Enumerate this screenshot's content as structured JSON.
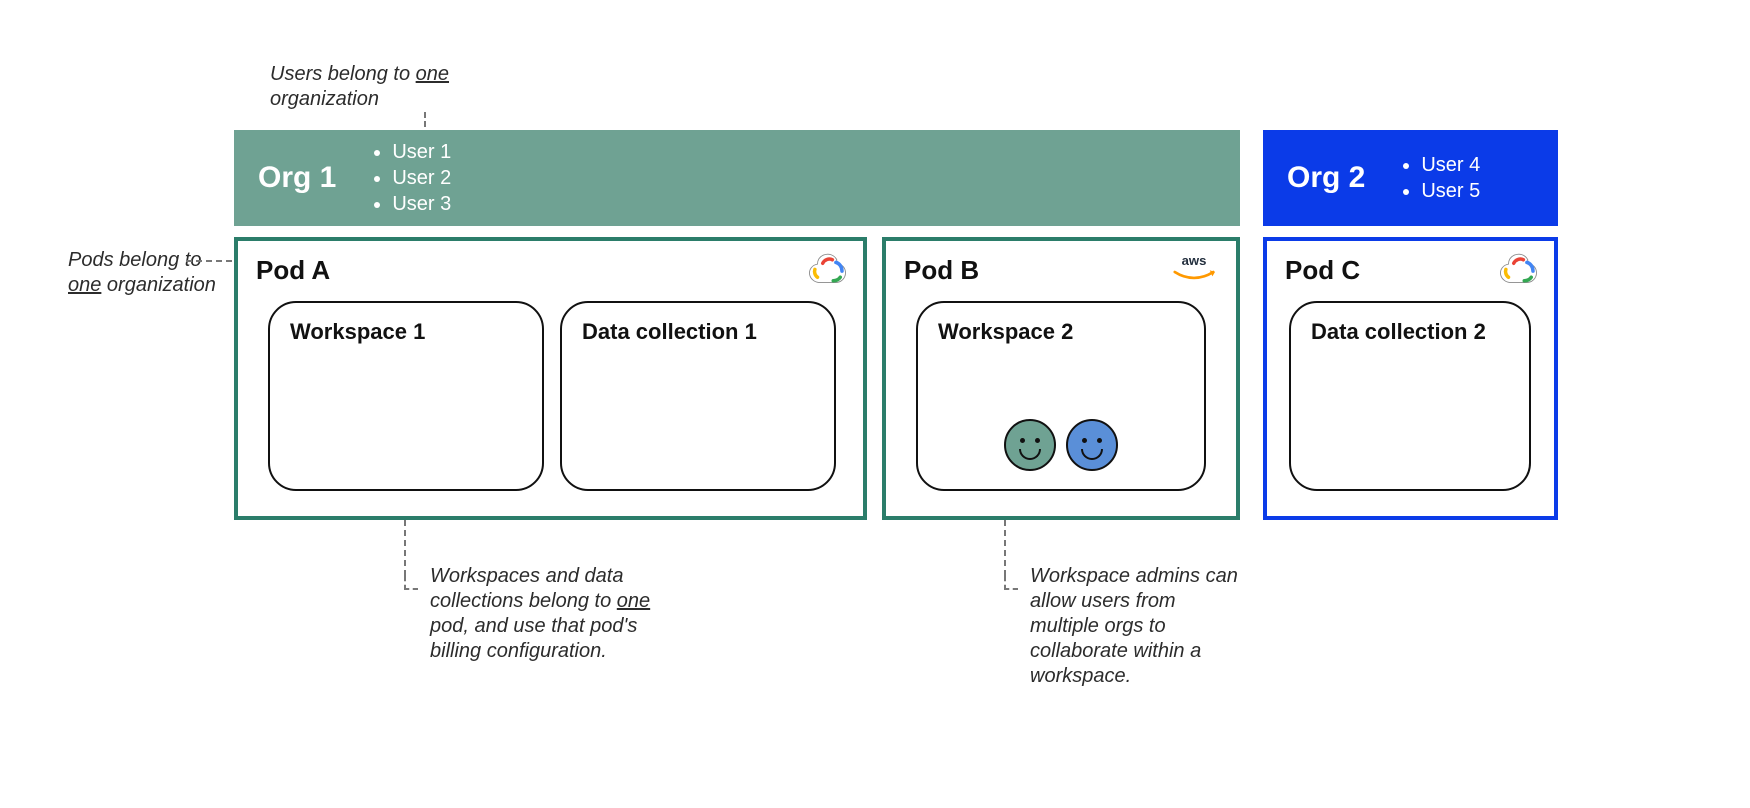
{
  "annotations": {
    "users_belong_pre": "Users belong to ",
    "users_belong_u": "one",
    "users_belong_post": " organization",
    "pods_belong_pre": "Pods belong to ",
    "pods_belong_u": "one",
    "pods_belong_post": " organization",
    "workspaces_pre": "Workspaces and data collections belong to ",
    "workspaces_u": "one",
    "workspaces_post": " pod, and  use that pod's billing configuration.",
    "admins": "Workspace admins can allow users from multiple orgs to collaborate within a workspace."
  },
  "org1": {
    "title": "Org 1",
    "users": [
      "User 1",
      "User 2",
      "User 3"
    ]
  },
  "org2": {
    "title": "Org 2",
    "users": [
      "User 4",
      "User 5"
    ]
  },
  "podA": {
    "title": "Pod A",
    "cloud": "gcp",
    "boxes": [
      {
        "title": "Workspace 1"
      },
      {
        "title": "Data collection 1"
      }
    ]
  },
  "podB": {
    "title": "Pod B",
    "cloud": "aws",
    "boxes": [
      {
        "title": "Workspace 2",
        "faces": [
          "green",
          "blue"
        ]
      }
    ]
  },
  "podC": {
    "title": "Pod C",
    "cloud": "gcp",
    "boxes": [
      {
        "title": "Data collection 2"
      }
    ]
  },
  "colors": {
    "org1": "#6fa293",
    "org2": "#0b3be8",
    "podGreen": "#2b7d6a",
    "podBlue": "#0b3be8"
  }
}
